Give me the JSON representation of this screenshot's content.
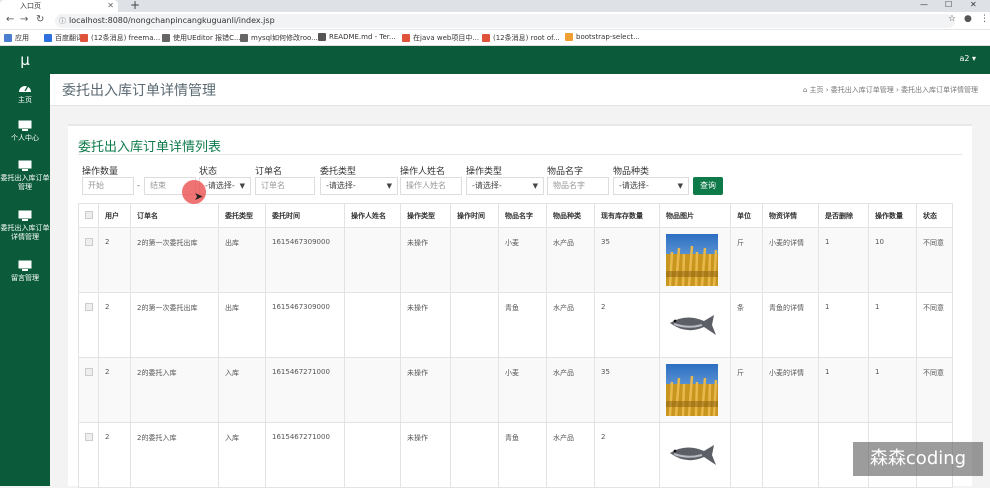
{
  "browser": {
    "tab_title": "入口页",
    "new_tab": "+",
    "window_controls": [
      "—",
      "☐",
      "✕"
    ],
    "url": "localhost:8080/nongchanpincangkuguanli/index.jsp",
    "bookmarks": [
      {
        "label": "应用",
        "color": "#4a7fd0"
      },
      {
        "label": "百度翻译",
        "color": "#2f6fde"
      },
      {
        "label": "(12条消息) freema...",
        "color": "#e0533b"
      },
      {
        "label": "使用UEditor 报错C...",
        "color": "#666666"
      },
      {
        "label": "mysql如何修改roo...",
        "color": "#666666"
      },
      {
        "label": "README.md - Ter...",
        "color": "#555555"
      },
      {
        "label": "在java web项目中...",
        "color": "#e0533b"
      },
      {
        "label": "(12条消息) root of...",
        "color": "#e0533b"
      },
      {
        "label": "bootstrap-select...",
        "color": "#f0a030"
      }
    ]
  },
  "app": {
    "brand": "μ",
    "user": "a2 ▾",
    "sidebar": [
      {
        "label": "主页",
        "icon": "dashboard-icon"
      },
      {
        "label": "个人中心",
        "icon": "monitor-icon"
      },
      {
        "label": "委托出入库订单管理",
        "icon": "monitor-icon"
      },
      {
        "label": "委托出入库订单详情管理",
        "icon": "monitor-icon"
      },
      {
        "label": "留言管理",
        "icon": "monitor-icon"
      }
    ],
    "page_title": "委托出入库订单详情管理",
    "breadcrumb": "⌂ 主页  ›  委托出入库订单管理  ›  委托出入库订单详情管理"
  },
  "list": {
    "title": "委托出入库订单详情列表",
    "filters": {
      "qty_label": "操作数量",
      "qty_start": "开始",
      "qty_sep": "-",
      "qty_end": "结束",
      "status_label": "状态",
      "status_value": "-请选择-",
      "order_label": "订单名",
      "order_placeholder": "订单名",
      "entrust_type_label": "委托类型",
      "entrust_type_value": "-请选择-",
      "operator_label": "操作人姓名",
      "operator_placeholder": "操作人姓名",
      "op_type_label": "操作类型",
      "op_type_value": "-请选择-",
      "goods_name_label": "物品名字",
      "goods_name_placeholder": "物品名字",
      "goods_kind_label": "物品种类",
      "goods_kind_value": "-请选择-",
      "search_button": "查询"
    },
    "columns": [
      "",
      "用户",
      "订单名",
      "委托类型",
      "委托时间",
      "操作人姓名",
      "操作类型",
      "操作时间",
      "物品名字",
      "物品种类",
      "现有库存数量",
      "物品图片",
      "单位",
      "物资详情",
      "是否删除",
      "操作数量",
      "状态"
    ],
    "rows": [
      {
        "user": "2",
        "order": "2的第一次委托出库",
        "type": "出库",
        "time": "1615467309000",
        "operator": "",
        "op_type": "未操作",
        "op_time": "",
        "goods": "小麦",
        "kind": "水产品",
        "stock": "35",
        "image": "wheat",
        "unit": "斤",
        "detail": "小麦的详情",
        "deleted": "1",
        "qty": "10",
        "status": "不同意"
      },
      {
        "user": "2",
        "order": "2的第一次委托出库",
        "type": "出库",
        "time": "1615467309000",
        "operator": "",
        "op_type": "未操作",
        "op_time": "",
        "goods": "青鱼",
        "kind": "水产品",
        "stock": "2",
        "image": "fish",
        "unit": "条",
        "detail": "青鱼的详情",
        "deleted": "1",
        "qty": "1",
        "status": "不同意"
      },
      {
        "user": "2",
        "order": "2的委托入库",
        "type": "入库",
        "time": "1615467271000",
        "operator": "",
        "op_type": "未操作",
        "op_time": "",
        "goods": "小麦",
        "kind": "水产品",
        "stock": "35",
        "image": "wheat",
        "unit": "斤",
        "detail": "小麦的详情",
        "deleted": "1",
        "qty": "1",
        "status": "不同意"
      },
      {
        "user": "2",
        "order": "2的委托入库",
        "type": "入库",
        "time": "1615467271000",
        "operator": "",
        "op_type": "未操作",
        "op_time": "",
        "goods": "青鱼",
        "kind": "水产品",
        "stock": "2",
        "image": "fish",
        "unit": "",
        "detail": "",
        "deleted": "",
        "qty": "",
        "status": ""
      }
    ]
  },
  "watermark": "森森coding"
}
